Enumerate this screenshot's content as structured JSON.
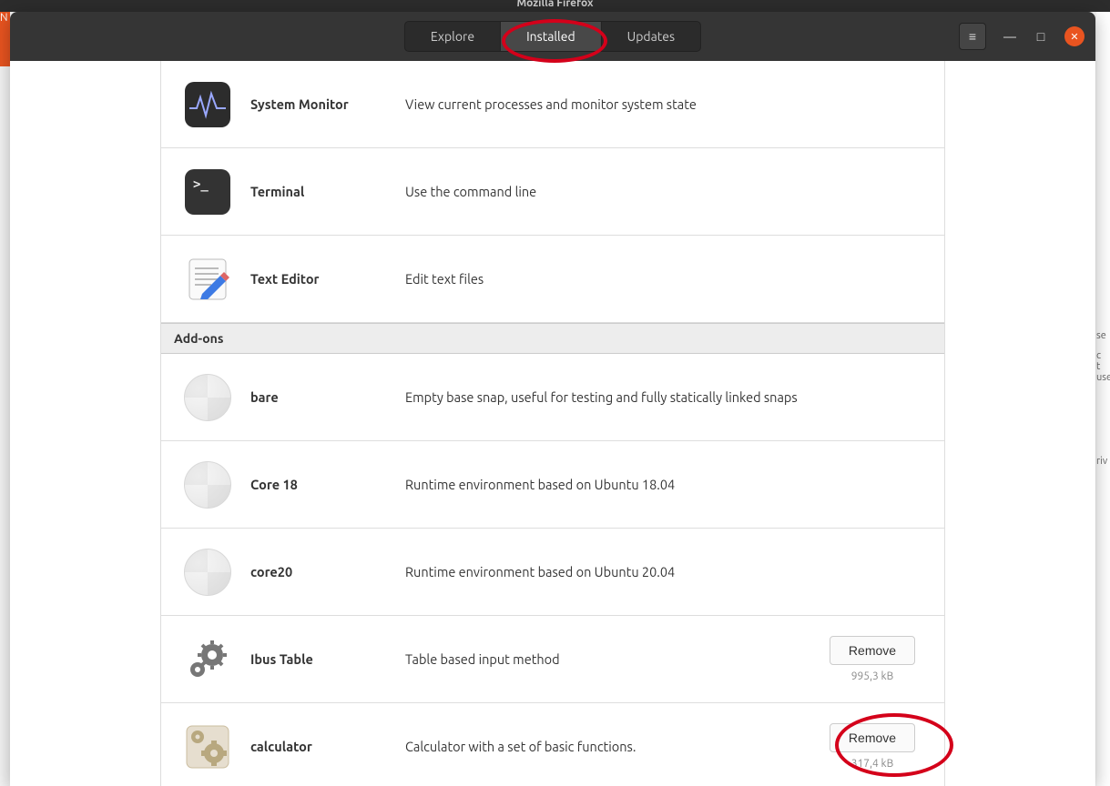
{
  "background": {
    "firefox_title": "Mozilla Firefox",
    "right_snippets": [
      "se",
      " c",
      " t",
      "use",
      "riv"
    ]
  },
  "header": {
    "tabs": {
      "explore": "Explore",
      "installed": "Installed",
      "updates": "Updates"
    }
  },
  "sections": {
    "addons_header": "Add-ons"
  },
  "apps": [
    {
      "id": "system-monitor",
      "name": "System Monitor",
      "desc": "View current processes and monitor system state",
      "icon": "system-monitor",
      "remove": null,
      "size": null
    },
    {
      "id": "terminal",
      "name": "Terminal",
      "desc": "Use the command line",
      "icon": "terminal",
      "remove": null,
      "size": null
    },
    {
      "id": "text-editor",
      "name": "Text Editor",
      "desc": "Edit text files",
      "icon": "text-editor",
      "remove": null,
      "size": null
    }
  ],
  "addons": [
    {
      "id": "bare",
      "name": "bare",
      "desc": "Empty base snap, useful for testing and fully statically linked snaps",
      "icon": "generic",
      "remove": null,
      "size": null
    },
    {
      "id": "core18",
      "name": "Core 18",
      "desc": "Runtime environment based on Ubuntu 18.04",
      "icon": "generic",
      "remove": null,
      "size": null
    },
    {
      "id": "core20",
      "name": "core20",
      "desc": "Runtime environment based on Ubuntu 20.04",
      "icon": "generic",
      "remove": null,
      "size": null
    },
    {
      "id": "ibus-table",
      "name": "Ibus Table",
      "desc": "Table based input method",
      "icon": "gears",
      "remove": "Remove",
      "size": "995,3 kB"
    },
    {
      "id": "calculator",
      "name": "calculator",
      "desc": "Calculator with a set of basic functions.",
      "icon": "gear-box",
      "remove": "Remove",
      "size": "317,4 kB"
    }
  ]
}
